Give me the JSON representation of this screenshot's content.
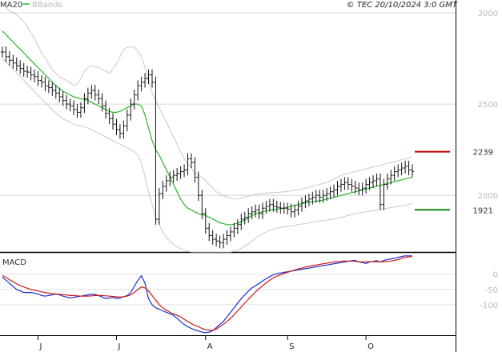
{
  "header": {
    "legend_ma": "MA20",
    "legend_bb": "BBands",
    "copyright": "© TEC 20/10/2024 3:0 GMT"
  },
  "colors": {
    "price": "#111111",
    "ma20": "#2db32d",
    "bbands": "#c8c8c8",
    "resistance": "#cc0000",
    "support": "#118811",
    "macd": "#1f2fd0",
    "signal": "#cc1a1a"
  },
  "chart_data": [
    {
      "type": "ohlc",
      "ylim": [
        1690,
        3070
      ],
      "y_ticks": [
        3000,
        2500,
        2000
      ],
      "y_tick_labels": [
        "3000",
        "2500",
        "2000"
      ],
      "levels": [
        {
          "label": "2239",
          "value": 2239,
          "role": "resistance"
        },
        {
          "label": "1921",
          "value": 1921,
          "role": "support"
        }
      ],
      "x_labels": [
        {
          "label": "J",
          "index": 10
        },
        {
          "label": "J",
          "index": 32
        },
        {
          "label": "A",
          "index": 57
        },
        {
          "label": "S",
          "index": 80
        },
        {
          "label": "O",
          "index": 102
        }
      ],
      "n": 116,
      "close": [
        2785,
        2760,
        2740,
        2725,
        2710,
        2695,
        2680,
        2675,
        2660,
        2650,
        2630,
        2620,
        2600,
        2590,
        2575,
        2560,
        2540,
        2520,
        2500,
        2490,
        2470,
        2455,
        2480,
        2530,
        2560,
        2575,
        2550,
        2530,
        2490,
        2450,
        2420,
        2390,
        2360,
        2340,
        2380,
        2440,
        2500,
        2550,
        2600,
        2620,
        2640,
        2660,
        2620,
        1870,
        2010,
        2050,
        2080,
        2100,
        2110,
        2120,
        2130,
        2140,
        2200,
        2180,
        2100,
        2000,
        1900,
        1820,
        1780,
        1760,
        1750,
        1740,
        1760,
        1780,
        1800,
        1820,
        1840,
        1870,
        1880,
        1900,
        1910,
        1920,
        1900,
        1930,
        1940,
        1950,
        1940,
        1935,
        1930,
        1930,
        1925,
        1910,
        1920,
        1940,
        1960,
        1970,
        1980,
        1990,
        2000,
        1990,
        2000,
        2010,
        2020,
        2030,
        2050,
        2060,
        2070,
        2060,
        2050,
        2040,
        2030,
        2040,
        2060,
        2070,
        2080,
        2090,
        1950,
        2060,
        2090,
        2110,
        2130,
        2140,
        2150,
        2160,
        2140,
        2130
      ],
      "ma20": [
        2900,
        2880,
        2860,
        2840,
        2820,
        2800,
        2780,
        2760,
        2740,
        2720,
        2700,
        2680,
        2660,
        2640,
        2620,
        2600,
        2585,
        2570,
        2560,
        2550,
        2540,
        2535,
        2530,
        2525,
        2520,
        2510,
        2500,
        2490,
        2480,
        2470,
        2460,
        2455,
        2455,
        2460,
        2470,
        2480,
        2490,
        2500,
        2500,
        2490,
        2440,
        2370,
        2300,
        2250,
        2220,
        2180,
        2140,
        2100,
        2060,
        2020,
        1980,
        1950,
        1930,
        1920,
        1910,
        1900,
        1895,
        1890,
        1880,
        1870,
        1860,
        1850,
        1845,
        1840,
        1840,
        1842,
        1848,
        1855,
        1865,
        1878,
        1890,
        1900,
        1905,
        1910,
        1915,
        1920,
        1922,
        1925,
        1928,
        1930,
        1935,
        1940,
        1945,
        1950,
        1955,
        1960,
        1963,
        1965,
        1968,
        1970,
        1975,
        1980,
        1985,
        1990,
        1995,
        2000,
        2005,
        2010,
        2015,
        2020,
        2025,
        2030,
        2035,
        2040,
        2045,
        2050,
        2055,
        2060,
        2065,
        2070,
        2075,
        2080,
        2085,
        2090,
        2095,
        2100
      ],
      "bb_upper": [
        3050,
        3030,
        3010,
        3000,
        2990,
        2970,
        2950,
        2920,
        2890,
        2860,
        2820,
        2780,
        2750,
        2720,
        2690,
        2670,
        2650,
        2640,
        2630,
        2620,
        2600,
        2610,
        2640,
        2680,
        2700,
        2710,
        2705,
        2700,
        2690,
        2680,
        2670,
        2690,
        2720,
        2760,
        2800,
        2810,
        2815,
        2810,
        2790,
        2760,
        2700,
        2630,
        2560,
        2520,
        2480,
        2440,
        2400,
        2360,
        2320,
        2280,
        2240,
        2200,
        2170,
        2150,
        2120,
        2110,
        2100,
        2080,
        2060,
        2040,
        2020,
        2010,
        2000,
        1990,
        1985,
        1980,
        1980,
        1985,
        1990,
        1995,
        2000,
        2005,
        2008,
        2010,
        2012,
        2014,
        2015,
        2016,
        2018,
        2020,
        2022,
        2025,
        2028,
        2030,
        2035,
        2040,
        2045,
        2050,
        2055,
        2060,
        2065,
        2070,
        2080,
        2090,
        2100,
        2110,
        2115,
        2120,
        2125,
        2130,
        2135,
        2140,
        2145,
        2150,
        2155,
        2160,
        2165,
        2170,
        2175,
        2180,
        2185,
        2190,
        2195,
        2200,
        2205,
        2210
      ],
      "bb_lower": [
        2750,
        2730,
        2710,
        2690,
        2670,
        2650,
        2630,
        2610,
        2590,
        2570,
        2550,
        2530,
        2510,
        2490,
        2470,
        2450,
        2435,
        2420,
        2410,
        2400,
        2390,
        2385,
        2380,
        2375,
        2370,
        2360,
        2350,
        2340,
        2330,
        2320,
        2310,
        2300,
        2290,
        2280,
        2270,
        2260,
        2250,
        2240,
        2220,
        2180,
        2100,
        2020,
        1950,
        1880,
        1840,
        1800,
        1770,
        1750,
        1730,
        1720,
        1710,
        1700,
        1695,
        1690,
        1690,
        1690,
        1690,
        1690,
        1690,
        1690,
        1690,
        1690,
        1690,
        1690,
        1690,
        1695,
        1700,
        1710,
        1720,
        1735,
        1750,
        1765,
        1780,
        1790,
        1800,
        1810,
        1815,
        1820,
        1825,
        1828,
        1830,
        1833,
        1836,
        1840,
        1843,
        1846,
        1850,
        1853,
        1856,
        1860,
        1862,
        1865,
        1868,
        1870,
        1875,
        1880,
        1885,
        1890,
        1895,
        1900,
        1903,
        1906,
        1910,
        1913,
        1916,
        1920,
        1923,
        1926,
        1930,
        1933,
        1936,
        1940,
        1943,
        1946,
        1950,
        1955
      ]
    },
    {
      "type": "line",
      "title": "MACD",
      "ylim": [
        -200,
        70
      ],
      "y_ticks": [
        0,
        -50,
        -100
      ],
      "y_tick_labels": [
        "0",
        "-50",
        "-100"
      ],
      "x_labels": [
        {
          "label": "J",
          "index": 10
        },
        {
          "label": "J",
          "index": 32
        },
        {
          "label": "A",
          "index": 57
        },
        {
          "label": "S",
          "index": 80
        },
        {
          "label": "O",
          "index": 102
        }
      ],
      "series": [
        {
          "values": [
            -10,
            -20,
            -30,
            -40,
            -50,
            -55,
            -60,
            -60,
            -60,
            -62,
            -65,
            -70,
            -72,
            -70,
            -68,
            -65,
            -68,
            -72,
            -75,
            -78,
            -76,
            -74,
            -72,
            -70,
            -68,
            -66,
            -66,
            -70,
            -75,
            -80,
            -78,
            -76,
            -80,
            -78,
            -74,
            -70,
            -60,
            -40,
            -20,
            -5,
            -30,
            -80,
            -100,
            -110,
            -115,
            -120,
            -125,
            -130,
            -135,
            -145,
            -155,
            -165,
            -172,
            -178,
            -183,
            -186,
            -190,
            -192,
            -190,
            -185,
            -175,
            -165,
            -155,
            -140,
            -125,
            -110,
            -95,
            -80,
            -68,
            -56,
            -45,
            -38,
            -30,
            -22,
            -15,
            -8,
            -2,
            2,
            4,
            6,
            8,
            10,
            12,
            14,
            16,
            18,
            20,
            22,
            24,
            26,
            28,
            30,
            32,
            34,
            36,
            38,
            40,
            42,
            44,
            45,
            40,
            38,
            35,
            40,
            42,
            44,
            40,
            45,
            48,
            50,
            52,
            55,
            58,
            60,
            60,
            60
          ]
        },
        {
          "values": [
            -5,
            -10,
            -18,
            -25,
            -32,
            -38,
            -42,
            -46,
            -50,
            -53,
            -55,
            -58,
            -60,
            -62,
            -64,
            -65,
            -66,
            -67,
            -68,
            -70,
            -70,
            -71,
            -72,
            -72,
            -72,
            -71,
            -70,
            -70,
            -70,
            -71,
            -72,
            -73,
            -74,
            -75,
            -74,
            -72,
            -68,
            -60,
            -50,
            -42,
            -45,
            -55,
            -70,
            -85,
            -100,
            -110,
            -118,
            -125,
            -130,
            -135,
            -140,
            -148,
            -155,
            -162,
            -168,
            -172,
            -178,
            -182,
            -184,
            -184,
            -180,
            -172,
            -164,
            -155,
            -145,
            -133,
            -120,
            -108,
            -95,
            -82,
            -70,
            -58,
            -48,
            -38,
            -28,
            -20,
            -12,
            -6,
            -2,
            2,
            6,
            10,
            14,
            17,
            20,
            23,
            26,
            28,
            30,
            32,
            34,
            36,
            38,
            40,
            41,
            42,
            43,
            43,
            43,
            42,
            41,
            40,
            40,
            41,
            41,
            41,
            40,
            41,
            42,
            43,
            45,
            48,
            52,
            55,
            57,
            58
          ]
        }
      ]
    }
  ]
}
